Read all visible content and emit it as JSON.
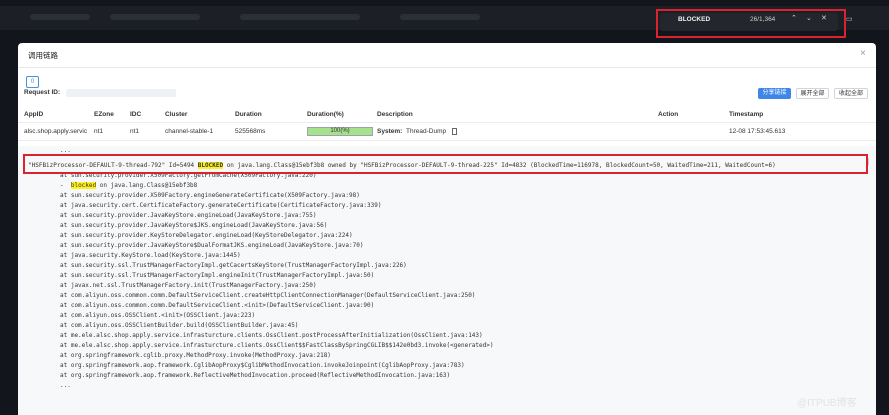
{
  "find_bar": {
    "term": "BLOCKED",
    "count": "26/1,364",
    "prev": "⌃",
    "next": "⌄",
    "close": "✕"
  },
  "modal": {
    "title": "调用链路",
    "close": "×",
    "chip": "0",
    "request_id_label": "Request ID:",
    "buttons": {
      "share": "分享链接",
      "expand_all": "展开全部",
      "collapse_all": "收起全部"
    },
    "columns": [
      "AppID",
      "EZone",
      "IDC",
      "Cluster",
      "Duration",
      "Duration(%)",
      "Description",
      "Action",
      "Timestamp"
    ],
    "row": {
      "appid": "alsc.shop.apply.servic",
      "ezone": "nt1",
      "idc": "nt1",
      "cluster": "channel-stable-1",
      "duration": "525568ms",
      "duration_pct_text": "100(%)",
      "duration_pct": 1.0,
      "desc_label": "System:",
      "desc_value": "Thread-Dump",
      "timestamp": "12-08 17:53:45.613"
    }
  },
  "stack": {
    "ellipsis_top": "...",
    "thread_prefix": "\"HSFBizProcessor-DEFAULT-9-thread-792\" Id=5494 ",
    "thread_state": "BLOCKED",
    "thread_suffix": " on java.lang.Class@15ebf3b8 owned by \"HSFBizProcessor-DEFAULT-9-thread-225\" Id=4832 (BlockedTime=116978, BlockedCount=50, WaitedTime=211, WaitedCount=6)",
    "frame_first": "at sun.security.provider.X509Factory.getFromCache(X509Factory.java:220)",
    "blocked_prefix": "-  ",
    "blocked_word": "blocked",
    "blocked_suffix": " on java.lang.Class@15ebf3b8",
    "frames": [
      "at sun.security.provider.X509Factory.engineGenerateCertificate(X509Factory.java:98)",
      "at java.security.cert.CertificateFactory.generateCertificate(CertificateFactory.java:339)",
      "at sun.security.provider.JavaKeyStore.engineLoad(JavaKeyStore.java:755)",
      "at sun.security.provider.JavaKeyStore$JKS.engineLoad(JavaKeyStore.java:56)",
      "at sun.security.provider.KeyStoreDelegator.engineLoad(KeyStoreDelegator.java:224)",
      "at sun.security.provider.JavaKeyStore$DualFormatJKS.engineLoad(JavaKeyStore.java:70)",
      "at java.security.KeyStore.load(KeyStore.java:1445)",
      "at sun.security.ssl.TrustManagerFactoryImpl.getCacertsKeyStore(TrustManagerFactoryImpl.java:226)",
      "at sun.security.ssl.TrustManagerFactoryImpl.engineInit(TrustManagerFactoryImpl.java:50)",
      "at javax.net.ssl.TrustManagerFactory.init(TrustManagerFactory.java:250)",
      "at com.aliyun.oss.common.comm.DefaultServiceClient.createHttpClientConnectionManager(DefaultServiceClient.java:250)",
      "at com.aliyun.oss.common.comm.DefaultServiceClient.<init>(DefaultServiceClient.java:90)",
      "at com.aliyun.oss.OSSClient.<init>(OSSClient.java:223)",
      "at com.aliyun.oss.OSSClientBuilder.build(OSSClientBuilder.java:45)",
      "at me.ele.alsc.shop.apply.service.infrasturcture.clients.OssClient.postProcessAfterInitialization(OssClient.java:143)",
      "at me.ele.alsc.shop.apply.service.infrasturcture.clients.OssClient$$FastClassBySpringCGLIB$$142e0bd3.invoke(<generated>)",
      "at org.springframework.cglib.proxy.MethodProxy.invoke(MethodProxy.java:218)",
      "at org.springframework.aop.framework.CglibAopProxy$CglibMethodInvocation.invokeJoinpoint(CglibAopProxy.java:783)",
      "at org.springframework.aop.framework.ReflectiveMethodInvocation.proceed(ReflectiveMethodInvocation.java:163)"
    ],
    "ellipsis_bottom": "..."
  },
  "watermark": "@ITPUB博客",
  "colors": {
    "highlight": "#fdf21d",
    "annotation_red": "#d9232e",
    "primary_blue": "#3e86e8",
    "progress_green": "#a6e18b"
  }
}
